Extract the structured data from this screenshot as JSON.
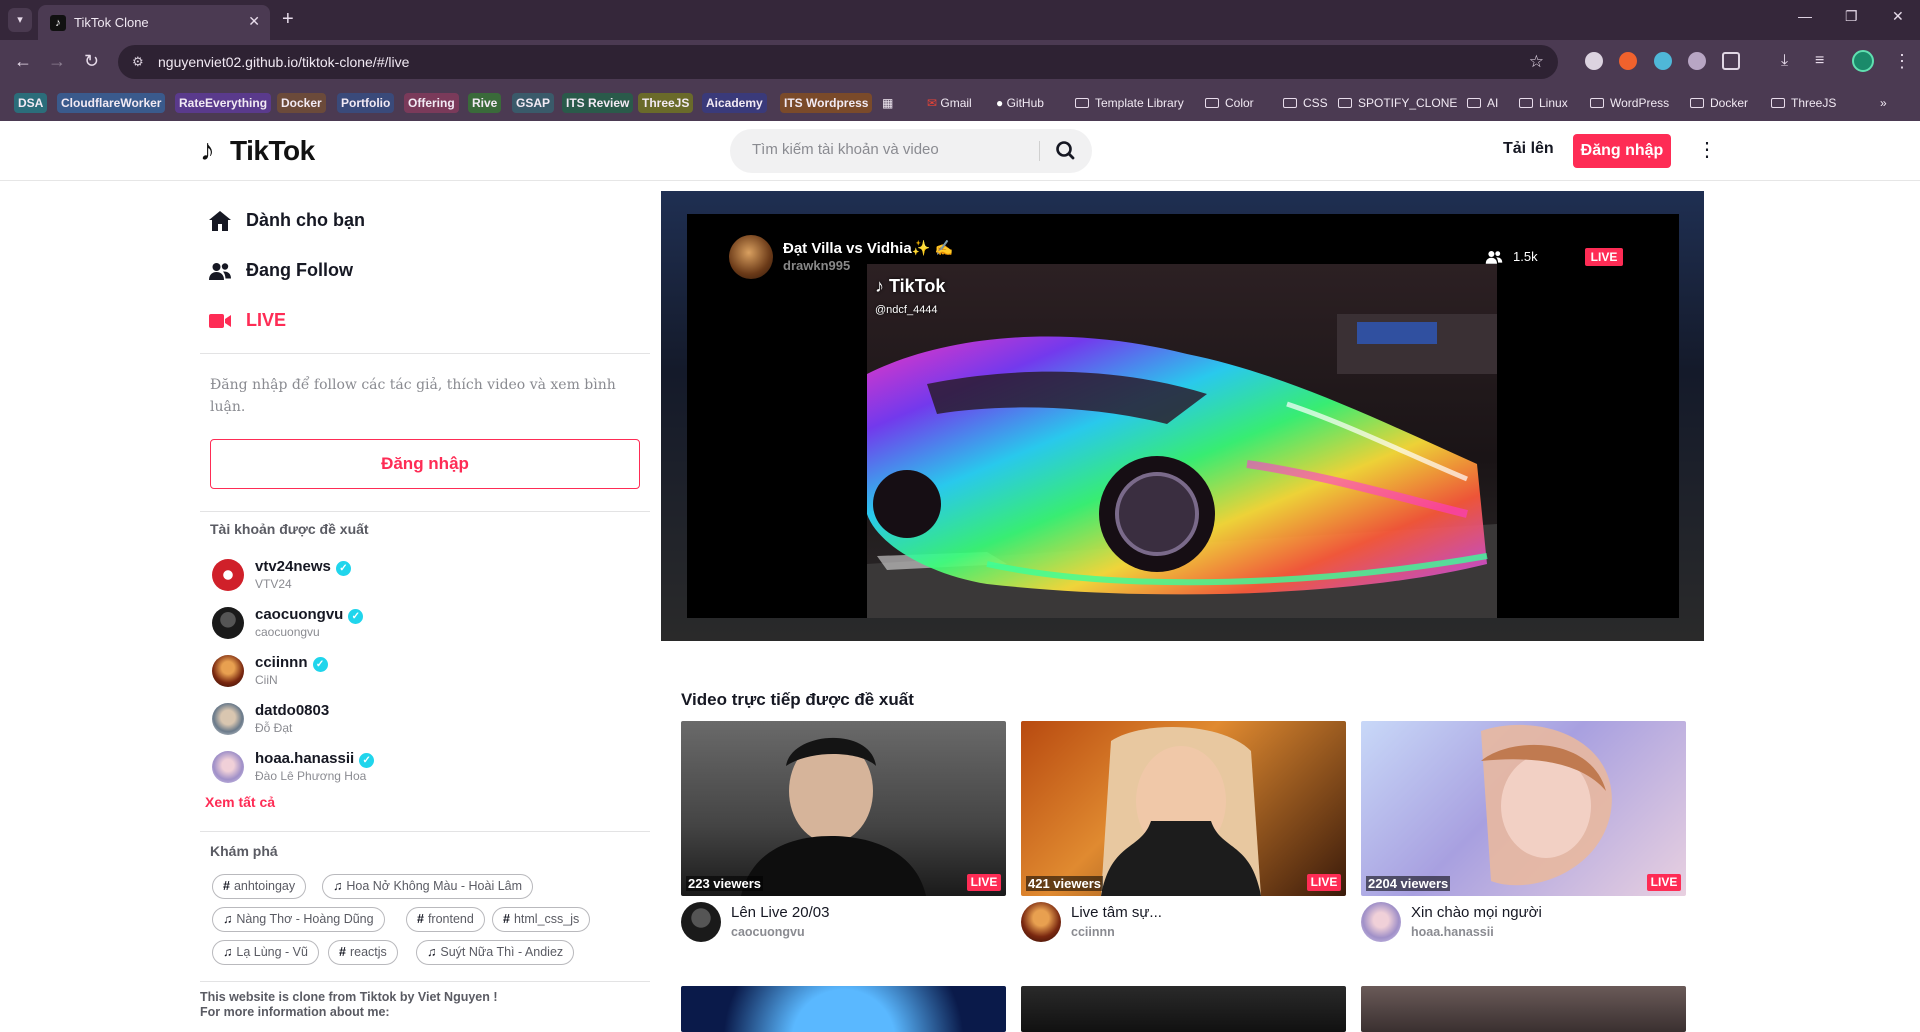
{
  "browser": {
    "tab_title": "TikTok Clone",
    "url": "nguyenviet02.github.io/tiktok-clone/#/live",
    "bookmarks": [
      {
        "label": "DSA",
        "bg": "#2b6d7a"
      },
      {
        "label": "CloudflareWorker",
        "bg": "#3a5a8c"
      },
      {
        "label": "RateEverything",
        "bg": "#5a3a8c"
      },
      {
        "label": "Docker",
        "bg": "#6b4a3a"
      },
      {
        "label": "Portfolio",
        "bg": "#3a4a7a"
      },
      {
        "label": "Offering",
        "bg": "#7a3a5a"
      },
      {
        "label": "Rive",
        "bg": "#3a6a3a"
      },
      {
        "label": "GSAP",
        "bg": "#3a5a6a"
      },
      {
        "label": "ITS Review",
        "bg": "#2a5a4a"
      },
      {
        "label": "ThreeJS",
        "bg": "#6a6a2a"
      },
      {
        "label": "Aicademy",
        "bg": "#3a3a7a"
      },
      {
        "label": "ITS Wordpress",
        "bg": "#7a4a2a"
      }
    ],
    "bookmark_links": [
      "Gmail",
      "GitHub"
    ],
    "bookmark_folders": [
      "Template Library",
      "Color",
      "CSS",
      "SPOTIFY_CLONE",
      "AI",
      "Linux",
      "WordPress",
      "Docker",
      "ThreeJS"
    ]
  },
  "header": {
    "logo_text": "TikTok",
    "search_placeholder": "Tìm kiếm tài khoản và video",
    "upload_label": "Tải lên",
    "login_label": "Đăng nhập"
  },
  "sidebar": {
    "nav": [
      {
        "label": "Dành cho bạn",
        "icon": "home-icon"
      },
      {
        "label": "Đang Follow",
        "icon": "users-icon"
      },
      {
        "label": "LIVE",
        "icon": "live-camera-icon"
      }
    ],
    "login_hint": "Đăng nhập để follow các tác giả, thích video và xem bình luận.",
    "login_button": "Đăng nhập",
    "suggested_title": "Tài khoản được đề xuất",
    "accounts": [
      {
        "username": "vtv24news",
        "nickname": "VTV24",
        "verified": true
      },
      {
        "username": "caocuongvu",
        "nickname": "caocuongvu",
        "verified": true
      },
      {
        "username": "cciinnn",
        "nickname": "CiiN",
        "verified": true
      },
      {
        "username": "datdo0803",
        "nickname": "Đỗ Đạt",
        "verified": false
      },
      {
        "username": "hoaa.hanassii",
        "nickname": "Đào Lê Phương Hoa",
        "verified": true
      }
    ],
    "see_all": "Xem tất cả",
    "discover_title": "Khám phá",
    "tags": [
      {
        "type": "hashtag",
        "label": "anhtoingay"
      },
      {
        "type": "music",
        "label": "Hoa Nở Không Màu - Hoài Lâm"
      },
      {
        "type": "music",
        "label": "Nàng Thơ - Hoàng Dũng"
      },
      {
        "type": "hashtag",
        "label": "frontend"
      },
      {
        "type": "hashtag",
        "label": "html_css_js"
      },
      {
        "type": "music",
        "label": "Lạ Lùng - Vũ"
      },
      {
        "type": "hashtag",
        "label": "reactjs"
      },
      {
        "type": "music",
        "label": "Suýt Nữa Thì - Andiez"
      }
    ],
    "footer_line1": "This website is clone from Tiktok by Viet Nguyen !",
    "footer_line2": "For more information about me:"
  },
  "live_player": {
    "host_name": "Đạt Villa vs Vidhia✨ ✍",
    "host_handle": "drawkn995",
    "viewers": "1.5k",
    "badge": "LIVE",
    "watermark": "TikTok",
    "watermark_handle": "@ndcf_4444"
  },
  "recommended": {
    "title": "Video trực tiếp được đề xuất",
    "badge": "LIVE",
    "cards": [
      {
        "viewers": "223 viewers",
        "title": "Lên Live 20/03",
        "user": "caocuongvu"
      },
      {
        "viewers": "421 viewers",
        "title": "Live tâm sự...",
        "user": "cciinnn"
      },
      {
        "viewers": "2204 viewers",
        "title": "Xin chào mọi người",
        "user": "hoaa.hanassii"
      }
    ]
  },
  "colors": {
    "brand": "#fe2c55",
    "verified": "#20d5ec",
    "chrome": "#4b3a52"
  }
}
